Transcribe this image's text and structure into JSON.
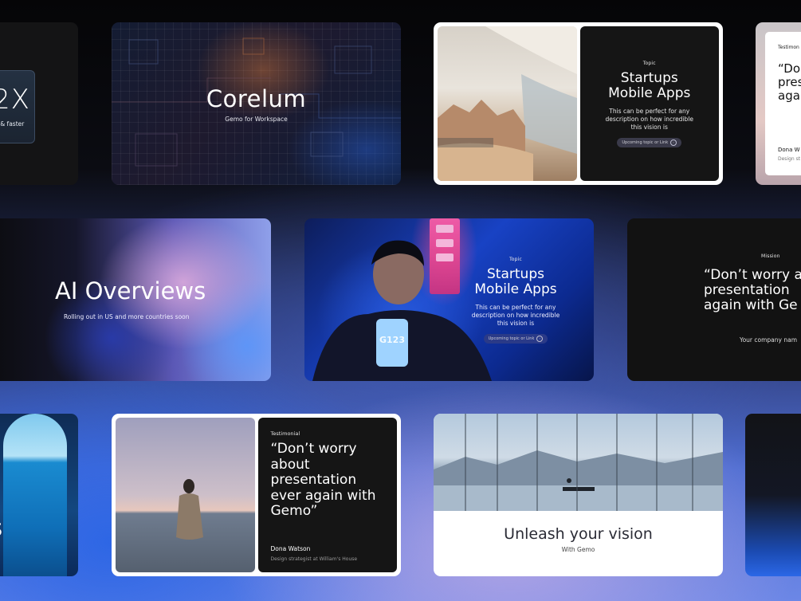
{
  "row1": {
    "badge": {
      "value": "2X",
      "caption": "t & faster"
    },
    "corelum": {
      "title": "Corelum",
      "subtitle": "Gemo for Workspace"
    },
    "startups_top": {
      "eyebrow": "Topic",
      "title": "Startups Mobile Apps",
      "body": "This can be perfect for any description on how incredible this vision is",
      "pill": "Upcoming topic or Link"
    },
    "testimonial_peek": {
      "label": "Testimon",
      "quote": "“Don pres again",
      "name": "Dona W",
      "role": "Design st"
    }
  },
  "row2": {
    "ai": {
      "title": "AI Overviews",
      "subtitle": "Rolling out in US and more countries soon"
    },
    "startups_mid": {
      "eyebrow": "Topic",
      "title": "Startups Mobile Apps",
      "body": "This can be perfect for any description on how incredible this vision is",
      "pill": "Upcoming topic or Link",
      "phone_text": "G123"
    },
    "mission": {
      "eyebrow": "Mission",
      "quote": "“Don’t worry a presentation again with Ge",
      "company": "Your company nam"
    }
  },
  "row3": {
    "ocean_letter": "s",
    "testimonial": {
      "label": "Testimonial",
      "quote": "“Don’t worry about presentation ever again with Gemo”",
      "name": "Dona Watson",
      "role": "Design strategist at William's House"
    },
    "unleash": {
      "title": "Unleash your vision",
      "subtitle": "With Gemo"
    }
  }
}
